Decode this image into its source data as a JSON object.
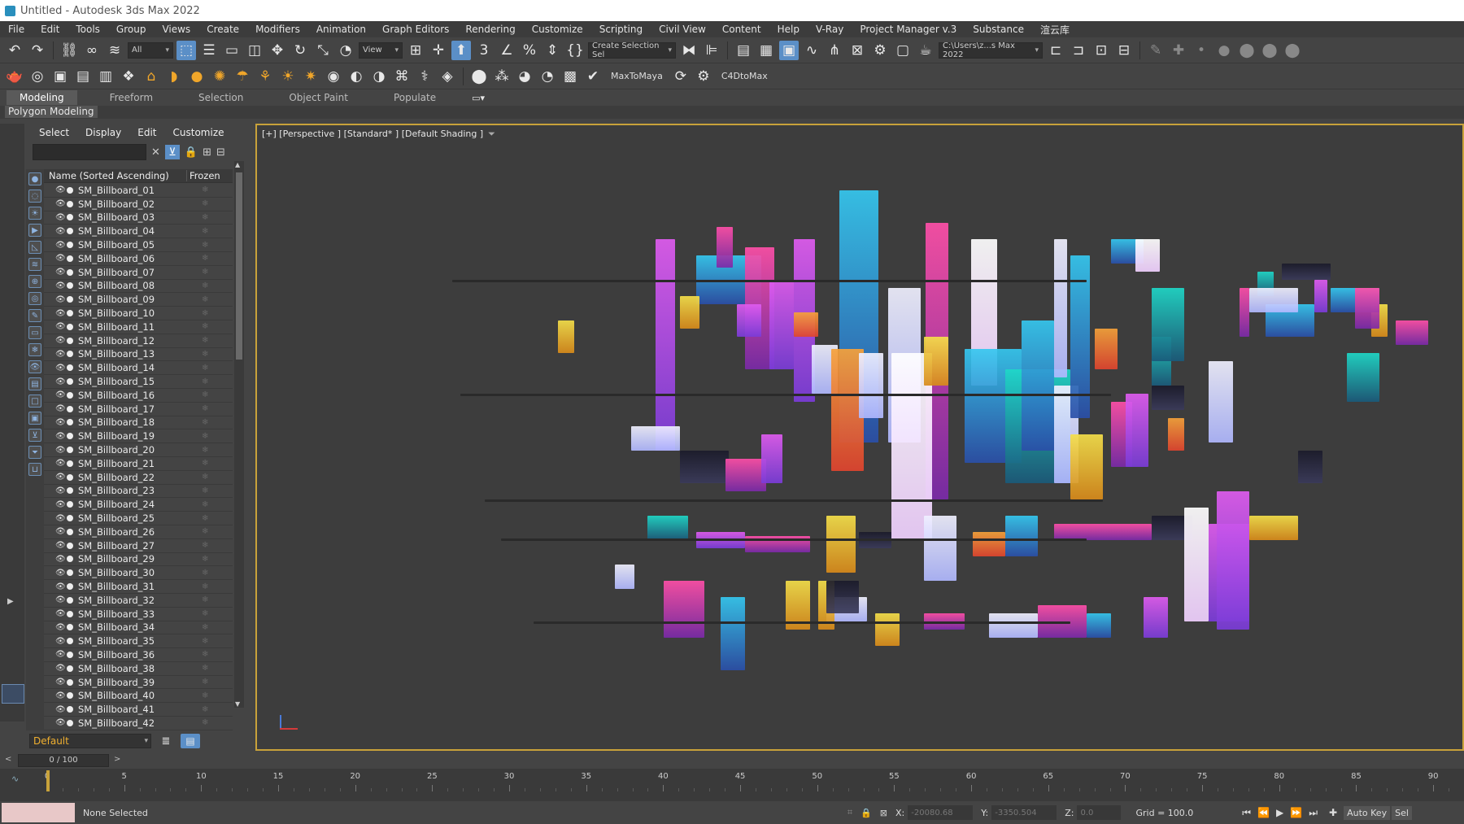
{
  "window": {
    "title": "Untitled - Autodesk 3ds Max 2022"
  },
  "menu": [
    "File",
    "Edit",
    "Tools",
    "Group",
    "Views",
    "Create",
    "Modifiers",
    "Animation",
    "Graph Editors",
    "Rendering",
    "Customize",
    "Scripting",
    "Civil View",
    "Content",
    "Help",
    "V-Ray",
    "Project Manager v.3",
    "Substance",
    "渲云库"
  ],
  "toolbar1": {
    "selection_filter": "All",
    "ref_coord": "View",
    "named_selection": "Create Selection Sel",
    "project_path": "C:\\Users\\z...s Max 2022"
  },
  "toolbar2": {
    "max_to_maya": "MaxToMaya",
    "c4d_to_max": "C4DtoMax"
  },
  "ribbon": {
    "tabs": [
      "Modeling",
      "Freeform",
      "Selection",
      "Object Paint",
      "Populate"
    ],
    "active_tab": "Modeling",
    "panel_label": "Polygon Modeling"
  },
  "scene_explorer": {
    "menu": [
      "Select",
      "Display",
      "Edit",
      "Customize"
    ],
    "column_name": "Name (Sorted Ascending)",
    "column_frozen": "Frozen",
    "objects": [
      "SM_Billboard_01",
      "SM_Billboard_02",
      "SM_Billboard_03",
      "SM_Billboard_04",
      "SM_Billboard_05",
      "SM_Billboard_06",
      "SM_Billboard_07",
      "SM_Billboard_08",
      "SM_Billboard_09",
      "SM_Billboard_10",
      "SM_Billboard_11",
      "SM_Billboard_12",
      "SM_Billboard_13",
      "SM_Billboard_14",
      "SM_Billboard_15",
      "SM_Billboard_16",
      "SM_Billboard_17",
      "SM_Billboard_18",
      "SM_Billboard_19",
      "SM_Billboard_20",
      "SM_Billboard_21",
      "SM_Billboard_22",
      "SM_Billboard_23",
      "SM_Billboard_24",
      "SM_Billboard_25",
      "SM_Billboard_26",
      "SM_Billboard_27",
      "SM_Billboard_29",
      "SM_Billboard_30",
      "SM_Billboard_31",
      "SM_Billboard_32",
      "SM_Billboard_33",
      "SM_Billboard_34",
      "SM_Billboard_35",
      "SM_Billboard_36",
      "SM_Billboard_38",
      "SM_Billboard_39",
      "SM_Billboard_40",
      "SM_Billboard_41",
      "SM_Billboard_42"
    ],
    "layer": "Default"
  },
  "viewport": {
    "label": "[+] [Perspective ] [Standard* ] [Default Shading ]"
  },
  "timeline": {
    "frame_display": "0 / 100",
    "ticks": [
      "0",
      "5",
      "10",
      "15",
      "20",
      "25",
      "30",
      "35",
      "40",
      "45",
      "50",
      "55",
      "60",
      "65",
      "70",
      "75",
      "80",
      "85",
      "90"
    ]
  },
  "status": {
    "selection": "None Selected",
    "x_label": "X:",
    "x": "-20080.68",
    "y_label": "Y:",
    "y": "-3350.504",
    "z_label": "Z:",
    "z": "0.0",
    "grid": "Grid = 100.0",
    "auto_key": "Auto Key",
    "set_key": "Sel"
  },
  "colors": {
    "accent_blue": "#5b8fc7",
    "viewport_border": "#c8a23a",
    "layer_text": "#f0b030"
  }
}
